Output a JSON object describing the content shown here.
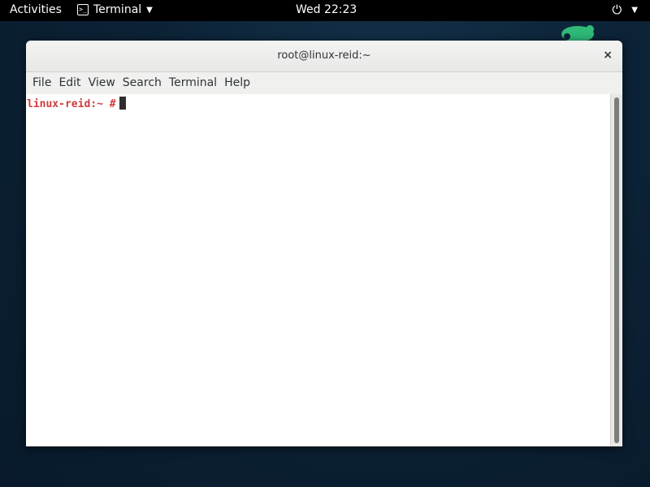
{
  "topbar": {
    "activities": "Activities",
    "app_name": "Terminal",
    "clock": "Wed 22:23",
    "icons": [
      "terminal-icon",
      "power-icon",
      "dropdown-caret-icon"
    ]
  },
  "window": {
    "title": "root@linux-reid:~",
    "close": "×",
    "menu": [
      "File",
      "Edit",
      "View",
      "Search",
      "Terminal",
      "Help"
    ],
    "terminal": {
      "prompt": "linux-reid:~ #"
    }
  },
  "colors": {
    "prompt": "#d13c3c",
    "logo": "#30ba78"
  }
}
